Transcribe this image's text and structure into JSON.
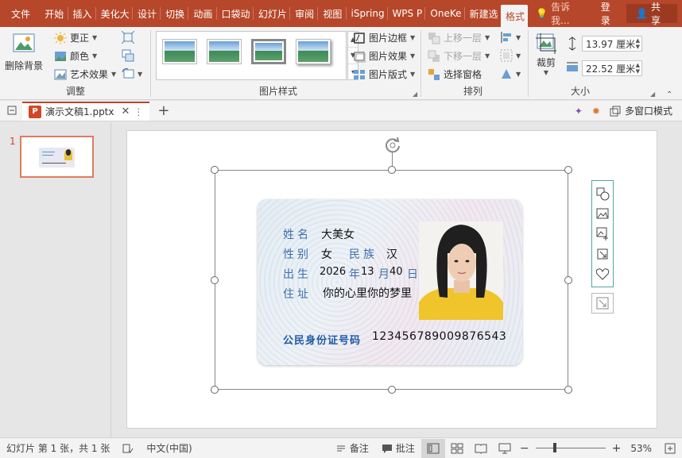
{
  "tabs": [
    {
      "label": "文件",
      "key": "file"
    },
    {
      "label": "开始"
    },
    {
      "label": "插入"
    },
    {
      "label": "美化大"
    },
    {
      "label": "设计"
    },
    {
      "label": "切换"
    },
    {
      "label": "动画"
    },
    {
      "label": "口袋动"
    },
    {
      "label": "幻灯片"
    },
    {
      "label": "审阅"
    },
    {
      "label": "视图"
    },
    {
      "label": "iSpring"
    },
    {
      "label": "WPS P"
    },
    {
      "label": "OneKe"
    },
    {
      "label": "新建选"
    },
    {
      "label": "格式",
      "active": true
    }
  ],
  "tell_me": "告诉我...",
  "login": "登录",
  "share": "共享",
  "ribbon": {
    "remove_bg": "删除背景",
    "corrections": "更正",
    "color": "颜色",
    "artistic": "艺术效果",
    "adjust_group": "调整",
    "picture_border": "图片边框",
    "picture_effects": "图片效果",
    "picture_layout": "图片版式",
    "styles_group": "图片样式",
    "bring_forward": "上移一层",
    "send_backward": "下移一层",
    "selection_pane": "选择窗格",
    "arrange_group": "排列",
    "crop": "裁剪",
    "height": "13.97 厘米",
    "width": "22.52 厘米",
    "size_group": "大小"
  },
  "doc": {
    "filename": "演示文稿1.pptx",
    "multi_window": "多窗口模式"
  },
  "slides": [
    {
      "number": "1"
    }
  ],
  "card": {
    "name_label": "姓名",
    "name_value": "大美女",
    "gender_label": "性别",
    "gender_value": "女",
    "ethnic_label": "民族",
    "ethnic_value": "汉",
    "birth_label": "出生",
    "birth_year": "2026",
    "birth_year_unit": "年",
    "birth_month": "13",
    "birth_month_unit": "月",
    "birth_day": "40",
    "birth_day_unit": "日",
    "address_label": "住址",
    "address_value": "你的心里你的梦里",
    "id_label": "公民身份证号码",
    "id_number": "123456789009876543"
  },
  "status": {
    "slide_info": "幻灯片 第 1 张，共 1 张",
    "language": "中文(中国)",
    "notes": "备注",
    "comments": "批注",
    "zoom": "53%"
  },
  "colors": {
    "accent": "#b7472a",
    "card_label": "#3d6fae"
  }
}
